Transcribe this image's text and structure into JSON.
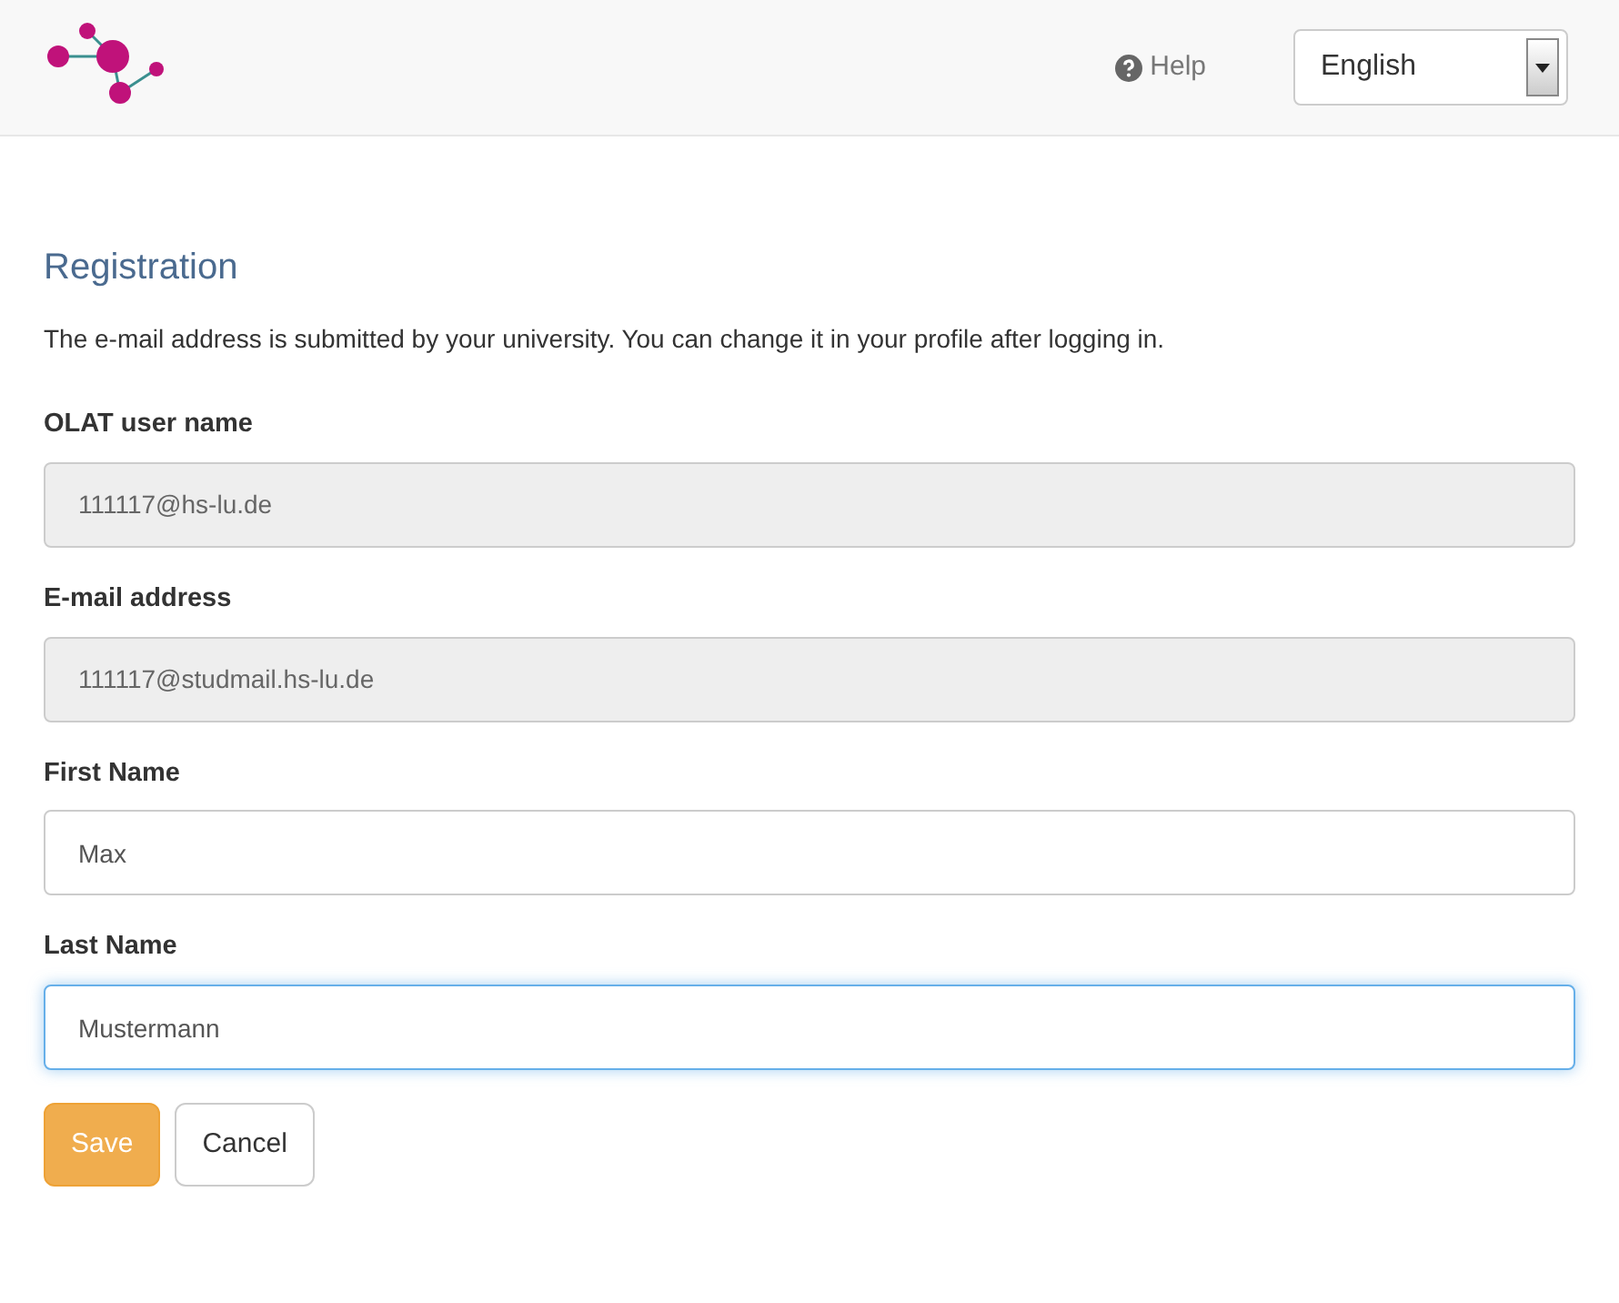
{
  "header": {
    "help": "Help",
    "language": "English"
  },
  "title": "Registration",
  "intro": "The e-mail address is submitted by your university. You can change it in your profile after logging in.",
  "fields": [
    {
      "label": "OLAT user name",
      "value": "111117@hs-lu.de",
      "disabled": true,
      "focused": false
    },
    {
      "label": "E-mail address",
      "value": "111117@studmail.hs-lu.de",
      "disabled": true,
      "focused": false
    },
    {
      "label": "First Name",
      "value": "Max",
      "disabled": false,
      "focused": false
    },
    {
      "label": "Last Name",
      "value": "Mustermann",
      "disabled": false,
      "focused": true
    }
  ],
  "buttons": [
    {
      "label": "Save",
      "kind": "primary"
    },
    {
      "label": "Cancel",
      "kind": "default"
    }
  ]
}
